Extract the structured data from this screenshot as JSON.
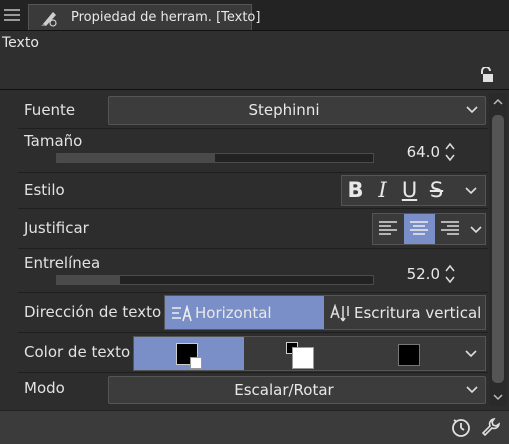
{
  "tab": {
    "title": "Propiedad de herram. [Texto]"
  },
  "tool": {
    "name": "Texto"
  },
  "properties": {
    "font": {
      "label": "Fuente",
      "value": "Stephinni"
    },
    "size": {
      "label": "Tamaño",
      "value": "64.0",
      "level": 0.5
    },
    "style": {
      "label": "Estilo",
      "buttons": [
        "B",
        "I",
        "U",
        "S"
      ]
    },
    "justify": {
      "label": "Justificar",
      "selected": "center"
    },
    "line_spacing": {
      "label": "Entrelínea",
      "value": "52.0",
      "level": 0.2
    },
    "direction": {
      "label": "Dirección de texto",
      "horizontal": "Horizontal",
      "vertical": "Escritura vertical",
      "selected": "horizontal"
    },
    "text_color": {
      "label": "Color de texto",
      "selected": "main"
    },
    "mode": {
      "label": "Modo",
      "value": "Escalar/Rotar"
    }
  },
  "colors": {
    "accent": "#7a8fc7",
    "panel": "#2d2d2d",
    "control": "#3c3c3c"
  },
  "icons": [
    "menu-icon",
    "text-tool-icon",
    "lock-icon",
    "chevron-down-icon",
    "spin-icon",
    "align-left-icon",
    "align-center-icon",
    "align-right-icon",
    "horizontal-text-icon",
    "vertical-text-icon",
    "scroll-up-icon",
    "scroll-down-icon",
    "clock-icon",
    "wrench-icon"
  ]
}
